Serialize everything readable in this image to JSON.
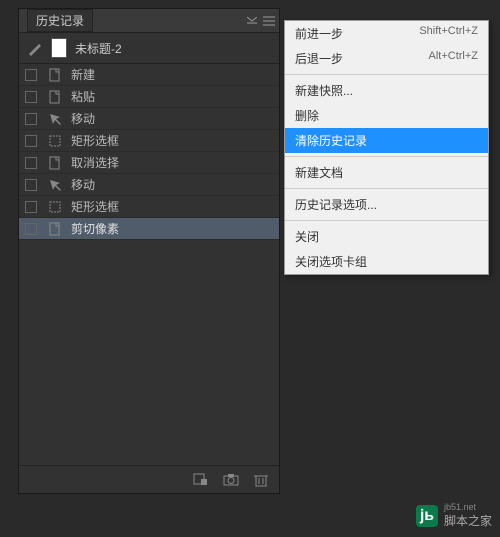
{
  "panel": {
    "title": "历史记录",
    "document_title": "未标题-2",
    "history": [
      {
        "icon": "file",
        "label": "新建"
      },
      {
        "icon": "file",
        "label": "粘贴"
      },
      {
        "icon": "move",
        "label": "移动"
      },
      {
        "icon": "marquee",
        "label": "矩形选框"
      },
      {
        "icon": "file",
        "label": "取消选择"
      },
      {
        "icon": "move",
        "label": "移动"
      },
      {
        "icon": "marquee",
        "label": "矩形选框"
      },
      {
        "icon": "file",
        "label": "剪切像素",
        "selected": true
      }
    ]
  },
  "menu": {
    "items": [
      {
        "label": "前进一步",
        "shortcut": "Shift+Ctrl+Z"
      },
      {
        "label": "后退一步",
        "shortcut": "Alt+Ctrl+Z"
      },
      {
        "sep": true
      },
      {
        "label": "新建快照..."
      },
      {
        "label": "删除"
      },
      {
        "label": "清除历史记录",
        "highlight": true
      },
      {
        "sep": true
      },
      {
        "label": "新建文档"
      },
      {
        "sep": true
      },
      {
        "label": "历史记录选项..."
      },
      {
        "sep": true
      },
      {
        "label": "关闭"
      },
      {
        "label": "关闭选项卡组"
      }
    ]
  },
  "watermark": {
    "url": "jb51.net",
    "text": "脚本之家"
  }
}
